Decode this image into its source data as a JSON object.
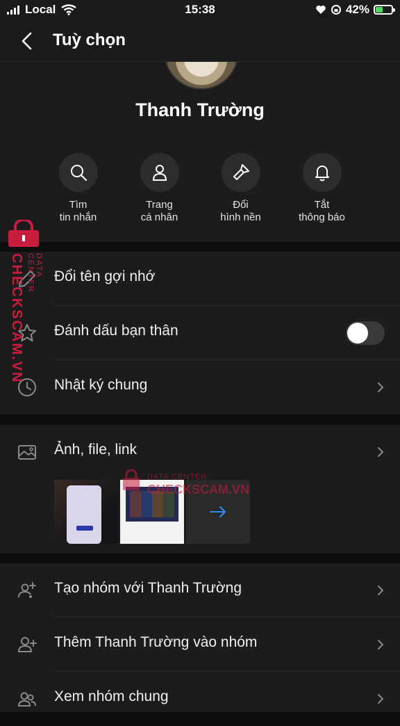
{
  "status": {
    "carrier": "Local",
    "time": "15:38",
    "battery": "42%",
    "battery_level": 0.42
  },
  "nav": {
    "title": "Tuỳ chọn"
  },
  "profile": {
    "name": "Thanh Trường"
  },
  "actions": [
    {
      "label": "Tìm\ntin nhắn",
      "icon": "search-icon"
    },
    {
      "label": "Trang\ncá nhân",
      "icon": "person-icon"
    },
    {
      "label": "Đổi\nhình nền",
      "icon": "brush-icon"
    },
    {
      "label": "Tắt\nthông báo",
      "icon": "bell-icon"
    }
  ],
  "settings": {
    "rename": "Đổi tên gợi nhớ",
    "best_friend": "Đánh dấu bạn thân",
    "best_friend_on": false,
    "diary": "Nhật ký chung"
  },
  "media": {
    "title": "Ảnh, file, link"
  },
  "groups": {
    "create": "Tạo nhóm với Thanh Trường",
    "add": "Thêm Thanh Trường vào nhóm",
    "common": "Xem nhóm chung"
  },
  "watermark": {
    "brand": "CHECKSCAM.VN",
    "sub": "DATA CENTER"
  }
}
